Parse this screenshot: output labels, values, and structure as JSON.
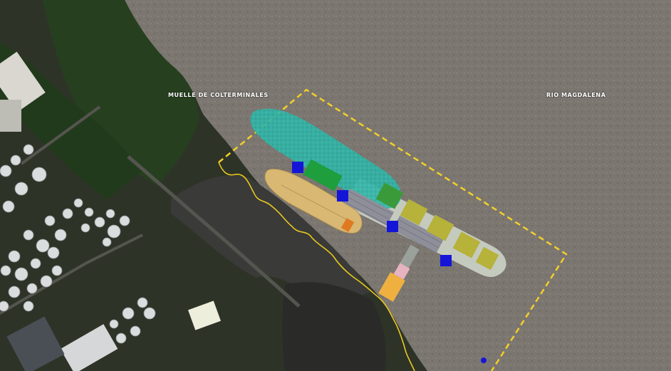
{
  "labels": {
    "dock": "MUELLE DE COLTERMINALES",
    "river": "RIO MAGDALENA"
  },
  "colors": {
    "river": "#7d7770",
    "land": "#2c3227",
    "vegetation": "#243a1e",
    "boundary": "#f2cf2a",
    "shoreline": "#e8c91e",
    "vessel_large": "#2fb4a6",
    "vessel_small": "#d8b872",
    "pier": "#c9cfc3",
    "pier_dark": "#8d8d95",
    "conveyor_green": "#1e9e3c",
    "hatch": "#b6b23a",
    "mooring_block": "#1515d8",
    "access_bridge": "#f0b040",
    "access_pink": "#e7b3c0",
    "storage_tank": "#d9ddde"
  },
  "icons": {
    "storage_tanks": "storage-tank-icon",
    "moored_vessel": "vessel-icon",
    "mooring_dolphin": "mooring-dolphin-icon"
  }
}
